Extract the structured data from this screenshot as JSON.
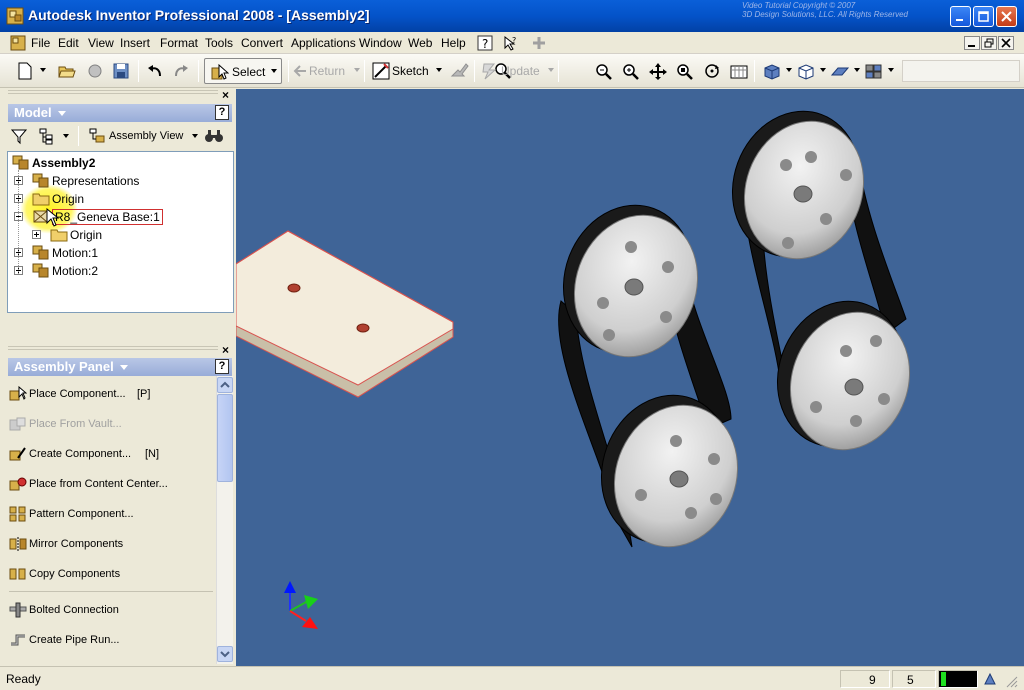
{
  "window": {
    "title": "Autodesk Inventor Professional 2008 - [Assembly2]",
    "watermark": "Video Tutorial Copyright © 2007\n3D Design Solutions, LLC. All Rights Reserved"
  },
  "menu": {
    "items": [
      {
        "label": "File",
        "key": "F",
        "rest": "ile"
      },
      {
        "label": "Edit",
        "key": "E",
        "rest": "dit"
      },
      {
        "label": "View",
        "key": "V",
        "rest": "iew"
      },
      {
        "label": "Insert",
        "key": "I",
        "rest": "nsert"
      },
      {
        "label": "Format",
        "key": "o",
        "pre": "F",
        "rest": "rmat"
      },
      {
        "label": "Tools",
        "key": "T",
        "rest": "ools"
      },
      {
        "label": "Convert",
        "key": "C",
        "rest": "onvert"
      },
      {
        "label": "Applications",
        "key": "A",
        "rest": "pplications"
      },
      {
        "label": "Window",
        "key": "W",
        "rest": "indow"
      },
      {
        "label": "Web",
        "key": "W",
        "rest": "eb"
      },
      {
        "label": "Help",
        "key": "H",
        "rest": "elp"
      }
    ]
  },
  "toolbar": {
    "select_label": "Select",
    "return_label": "Return",
    "sketch_label": "Sketch",
    "update_label": "Update"
  },
  "model_browser": {
    "header": "Model",
    "view_label": "Assembly View",
    "tree": [
      {
        "label": "Assembly2",
        "level": 0,
        "bold": true
      },
      {
        "label": "Representations",
        "level": 1
      },
      {
        "label": "Origin",
        "level": 1
      },
      {
        "label": "R8_Geneva Base:1",
        "level": 1,
        "selected": true
      },
      {
        "label": "Origin",
        "level": 2
      },
      {
        "label": "Motion:1",
        "level": 1
      },
      {
        "label": "Motion:2",
        "level": 1
      }
    ]
  },
  "assembly_panel": {
    "header": "Assembly Panel",
    "items": [
      {
        "label": "Place Component...",
        "shortcut": "[P]",
        "enabled": true
      },
      {
        "label": "Place From Vault...",
        "shortcut": "",
        "enabled": false
      },
      {
        "label": "Create Component...",
        "shortcut": "[N]",
        "enabled": true
      },
      {
        "label": "Place from Content Center...",
        "shortcut": "",
        "enabled": true
      },
      {
        "label": "Pattern Component...",
        "shortcut": "",
        "enabled": true
      },
      {
        "label": "Mirror Components",
        "shortcut": "",
        "enabled": true
      },
      {
        "label": "Copy Components",
        "shortcut": "",
        "enabled": true
      },
      {
        "label": "Bolted Connection",
        "shortcut": "",
        "enabled": true
      },
      {
        "label": "Create Pipe Run...",
        "shortcut": "",
        "enabled": true
      }
    ]
  },
  "status": {
    "text": "Ready",
    "field1": "9",
    "field2": "5"
  },
  "colors": {
    "viewport_bg": "#3f6497",
    "titlebar": "#0453c9",
    "pane_header": "#98acd8"
  }
}
